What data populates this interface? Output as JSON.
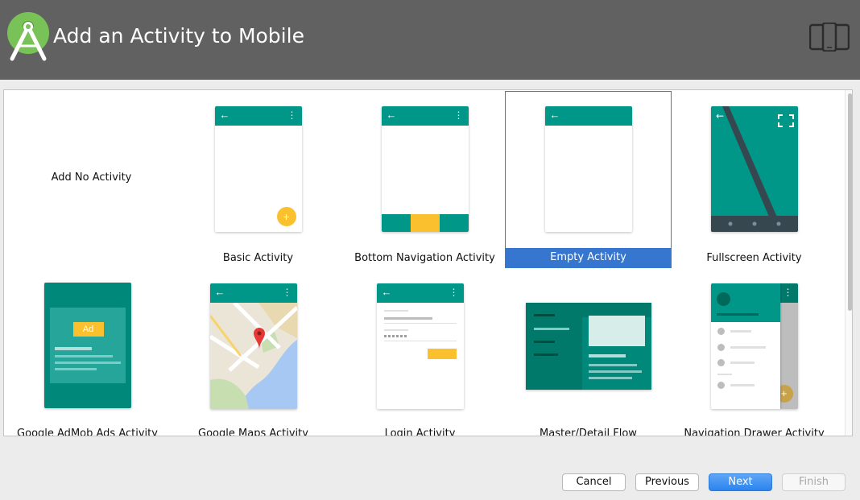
{
  "header": {
    "title": "Add an Activity to Mobile",
    "logo_icon": "android-studio-logo",
    "device_icon": "phone-tablet-icon"
  },
  "colors": {
    "header_bg": "#616161",
    "teal": "#009688",
    "amber": "#fbc02d",
    "selection": "#3676cf"
  },
  "templates": [
    {
      "label": "Add No Activity",
      "icon": "no-activity",
      "selected": false
    },
    {
      "label": "Basic Activity",
      "icon": "basic-activity-thumbnail",
      "selected": false
    },
    {
      "label": "Bottom Navigation Activity",
      "icon": "bottom-navigation-thumbnail",
      "selected": false
    },
    {
      "label": "Empty Activity",
      "icon": "empty-activity-thumbnail",
      "selected": true
    },
    {
      "label": "Fullscreen Activity",
      "icon": "fullscreen-activity-thumbnail",
      "selected": false
    },
    {
      "label": "Google AdMob Ads Activity",
      "icon": "admob-thumbnail",
      "selected": false,
      "badge": "Ad"
    },
    {
      "label": "Google Maps Activity",
      "icon": "maps-thumbnail",
      "selected": false
    },
    {
      "label": "Login Activity",
      "icon": "login-thumbnail",
      "selected": false
    },
    {
      "label": "Master/Detail Flow",
      "icon": "master-detail-thumbnail",
      "selected": false
    },
    {
      "label": "Navigation Drawer Activity",
      "icon": "navigation-drawer-thumbnail",
      "selected": false
    }
  ],
  "buttons": {
    "cancel": "Cancel",
    "previous": "Previous",
    "next": "Next",
    "finish": "Finish"
  }
}
